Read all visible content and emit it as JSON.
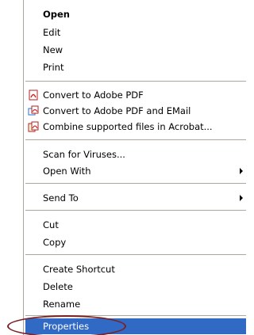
{
  "menu": {
    "open_label": "Open",
    "edit_label": "Edit",
    "new_label": "New",
    "print_label": "Print",
    "convert_pdf_label": "Convert to Adobe PDF",
    "convert_pdf_email_label": "Convert to Adobe PDF and EMail",
    "combine_label": "Combine supported files in Acrobat...",
    "scan_label": "Scan for Viruses...",
    "open_with_label": "Open With",
    "send_to_label": "Send To",
    "cut_label": "Cut",
    "copy_label": "Copy",
    "create_shortcut_label": "Create Shortcut",
    "delete_label": "Delete",
    "rename_label": "Rename",
    "properties_label": "Properties"
  },
  "colors": {
    "selection": "#316ac5",
    "annotation": "#7b1f23",
    "separator": "#aca899"
  },
  "icons": {
    "convert_pdf": "adobe-pdf-icon",
    "convert_pdf_email": "adobe-pdf-email-icon",
    "combine": "acrobat-combine-icon",
    "open_with_submenu": "chevron-right-icon",
    "send_to_submenu": "chevron-right-icon"
  }
}
